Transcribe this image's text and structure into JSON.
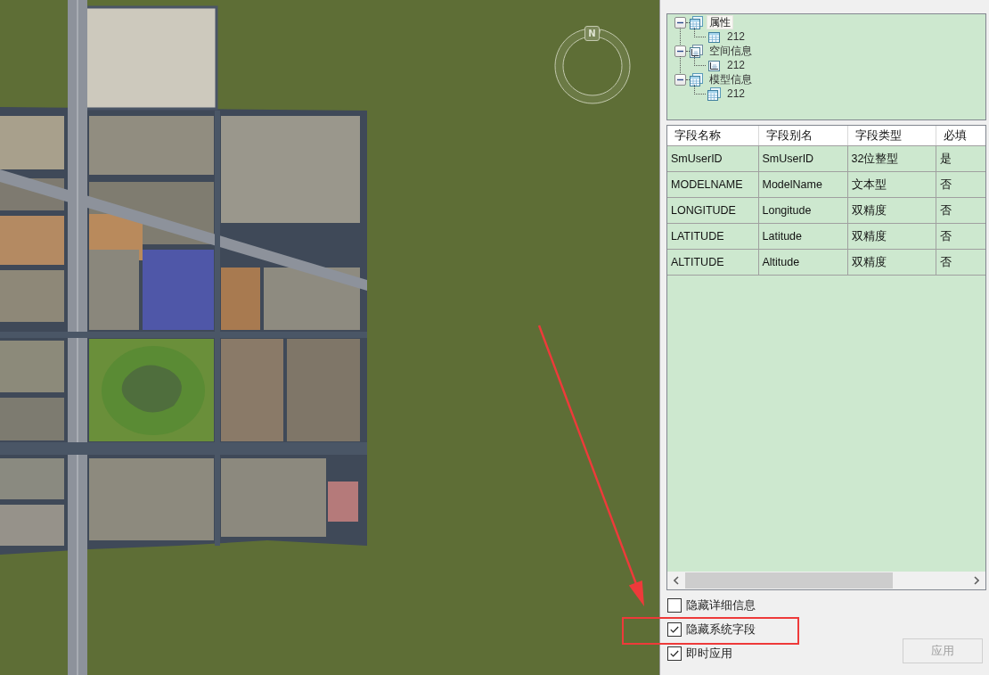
{
  "map": {
    "compass": {
      "north_label": "N"
    }
  },
  "panel": {
    "tree": [
      {
        "label": "属性",
        "kind": "table-stack",
        "selected": true,
        "expanded": true,
        "children": [
          {
            "label": "212",
            "kind": "table",
            "selected": false
          }
        ]
      },
      {
        "label": "空间信息",
        "kind": "chart-stack",
        "selected": false,
        "expanded": true,
        "children": [
          {
            "label": "212",
            "kind": "chart",
            "selected": false
          }
        ]
      },
      {
        "label": "模型信息",
        "kind": "table-stack",
        "selected": false,
        "expanded": true,
        "children": [
          {
            "label": "212",
            "kind": "table-stack",
            "selected": false
          }
        ]
      }
    ],
    "table": {
      "columns": [
        "字段名称",
        "字段别名",
        "字段类型",
        "必填"
      ],
      "rows": [
        [
          "SmUserID",
          "SmUserID",
          "32位整型",
          "是"
        ],
        [
          "MODELNAME",
          "ModelName",
          "文本型",
          "否"
        ],
        [
          "LONGITUDE",
          "Longitude",
          "双精度",
          "否"
        ],
        [
          "LATITUDE",
          "Latitude",
          "双精度",
          "否"
        ],
        [
          "ALTITUDE",
          "Altitude",
          "双精度",
          "否"
        ]
      ]
    },
    "options": [
      {
        "label": "隐藏详细信息",
        "checked": false
      },
      {
        "label": "隐藏系统字段",
        "checked": true
      },
      {
        "label": "即时应用",
        "checked": true
      }
    ],
    "apply_button": {
      "label": "应用",
      "disabled": true
    }
  }
}
